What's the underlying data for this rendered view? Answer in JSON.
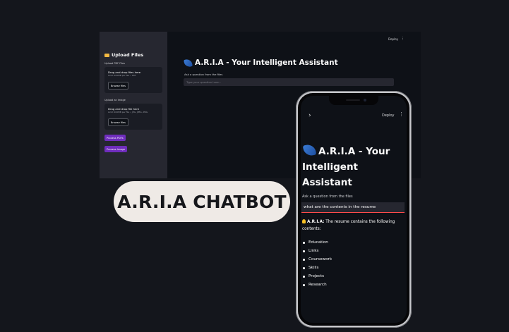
{
  "desktop": {
    "sidebar": {
      "title": "Upload Files",
      "pdf_label": "Upload PDF Files",
      "pdf_drop_text": "Drag and drop files here",
      "pdf_limit": "Limit 200MB per file • PDF",
      "browse_label": "Browse files",
      "image_label": "Upload an Image",
      "image_drop_text": "Drag and drop file here",
      "image_limit": "Limit 200MB per file • JPG, JPEG, PNG",
      "process_pdfs": "Process PDFs",
      "process_image": "Process Image"
    },
    "header": {
      "deploy": "Deploy",
      "menu": "⋮"
    },
    "main": {
      "title": "A.R.I.A - Your Intelligent Assistant",
      "ask_label": "Ask a question from the files",
      "input_placeholder": "Type your question here..."
    }
  },
  "banner": {
    "text": "A.R.I.A CHATBOT"
  },
  "phone": {
    "back": "›",
    "deploy": "Deploy",
    "menu": "⋮",
    "title": "A.R.I.A - Your Intelligent Assistant",
    "ask_label": "Ask a question from the files",
    "input_value": "what are the contents in the resume",
    "answer_speaker": "A.R.I.A:",
    "answer_text": "The resume contains the following contents:",
    "answer_items": [
      "Education",
      "Links",
      "Coursework",
      "Skills",
      "Projects",
      "Research"
    ]
  },
  "colors": {
    "background": "#14161c",
    "app_background": "#0e1117",
    "sidebar": "#262730",
    "accent_purple": "#6f2dbd",
    "input_focus": "#ff4b4b",
    "banner": "#efeae6"
  }
}
